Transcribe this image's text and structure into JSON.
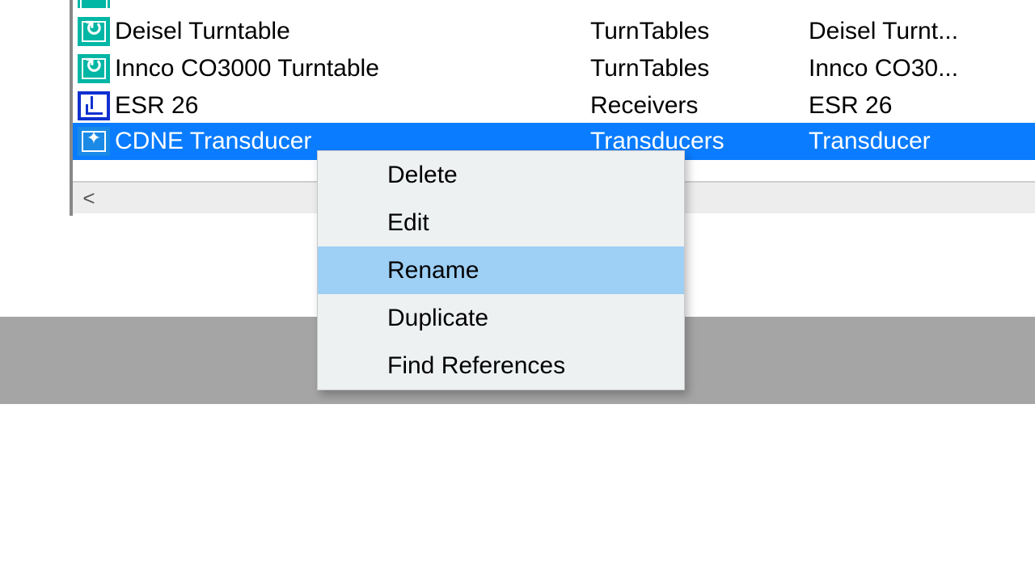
{
  "list": {
    "rows": [
      {
        "name": "Deisel Turntable",
        "category": "TurnTables",
        "desc": "Deisel Turnt...",
        "icon": "turntable",
        "selected": false
      },
      {
        "name": "Innco CO3000 Turntable",
        "category": "TurnTables",
        "desc": "Innco CO30...",
        "icon": "turntable",
        "selected": false
      },
      {
        "name": "ESR 26",
        "category": "Receivers",
        "desc": "ESR 26",
        "icon": "receiver",
        "selected": false
      },
      {
        "name": "CDNE Transducer",
        "category": "Transducers",
        "desc": "Transducer",
        "icon": "transducer",
        "selected": true
      }
    ]
  },
  "context_menu": {
    "items": [
      {
        "label": "Delete",
        "hover": false
      },
      {
        "label": "Edit",
        "hover": false
      },
      {
        "label": "Rename",
        "hover": true
      },
      {
        "label": "Duplicate",
        "hover": false
      },
      {
        "label": "Find References",
        "hover": false
      }
    ]
  },
  "scrollbar": {
    "left_arrow": "<"
  }
}
